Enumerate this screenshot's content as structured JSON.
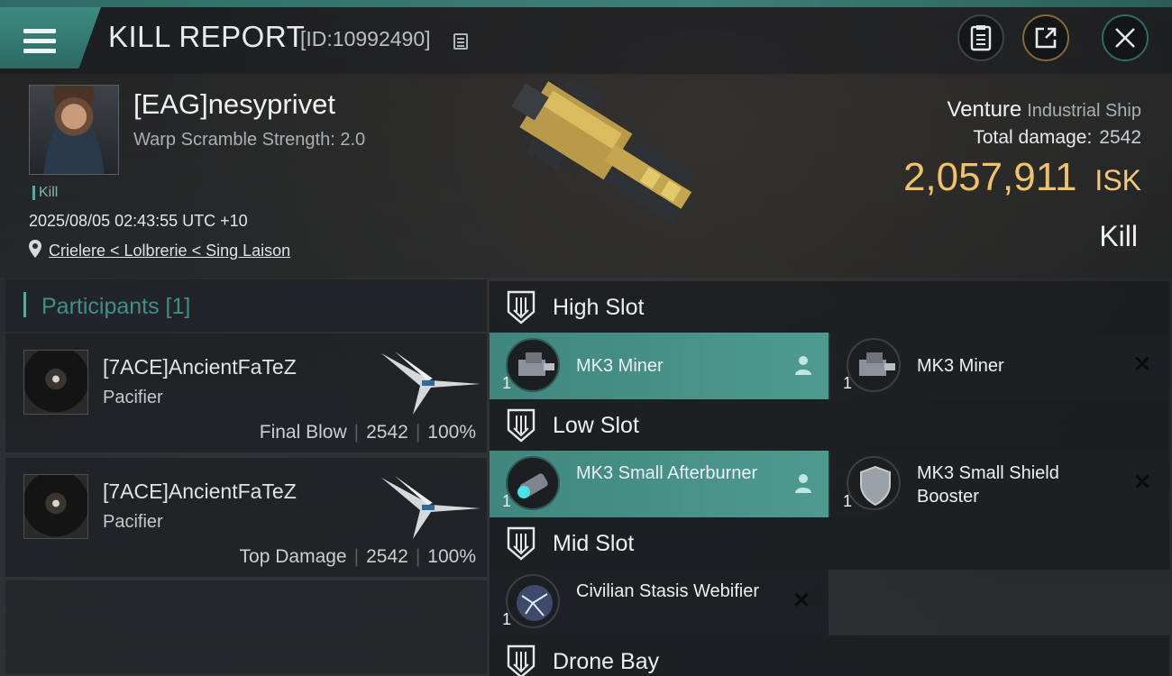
{
  "header": {
    "title": "KILL REPORT",
    "report_id": "[ID:10992490]"
  },
  "victim": {
    "name": "[EAG]nesyprivet",
    "warp_scramble": "Warp Scramble Strength: 2.0",
    "tag": "Kill",
    "datetime": "2025/08/05 02:43:55 UTC +10",
    "location": "Crielere < Lolbrerie < Sing Laison",
    "ship_name": "Venture",
    "ship_class": "Industrial Ship",
    "total_damage_label": "Total damage:",
    "total_damage": "2542",
    "isk_value": "2,057,911",
    "isk_unit": "ISK",
    "result": "Kill"
  },
  "participants": {
    "title": "Participants [1]",
    "items": [
      {
        "name": "[7ACE]AncientFaTeZ",
        "ship": "Pacifier",
        "role": "Final Blow",
        "damage": "2542",
        "percent": "100%"
      },
      {
        "name": "[7ACE]AncientFaTeZ",
        "ship": "Pacifier",
        "role": "Top Damage",
        "damage": "2542",
        "percent": "100%"
      }
    ]
  },
  "slots": {
    "high": {
      "title": "High Slot",
      "modules": [
        {
          "name": "MK3 Miner",
          "qty": "1",
          "status": "fitted"
        },
        {
          "name": "MK3 Miner",
          "qty": "1",
          "status": "destroyed"
        }
      ]
    },
    "low": {
      "title": "Low Slot",
      "modules": [
        {
          "name": "MK3 Small Afterburner",
          "qty": "1",
          "status": "fitted"
        },
        {
          "name": "MK3 Small Shield Booster",
          "qty": "1",
          "status": "destroyed"
        }
      ]
    },
    "mid": {
      "title": "Mid Slot",
      "modules": [
        {
          "name": "Civilian Stasis Webifier",
          "qty": "1",
          "status": "destroyed"
        }
      ]
    },
    "drone": {
      "title": "Drone Bay"
    }
  },
  "colors": {
    "accent": "#4e9a91",
    "isk": "#f0c36a",
    "participants_title": "#3f8f86"
  },
  "icons": {
    "menu": "hamburger-icon",
    "copy": "copy-icon",
    "clipboard": "clipboard-icon",
    "export": "export-icon",
    "close": "close-icon",
    "location": "map-pin-icon",
    "slot": "slot-icon",
    "pilot": "person-icon",
    "destroyed": "x-icon"
  }
}
